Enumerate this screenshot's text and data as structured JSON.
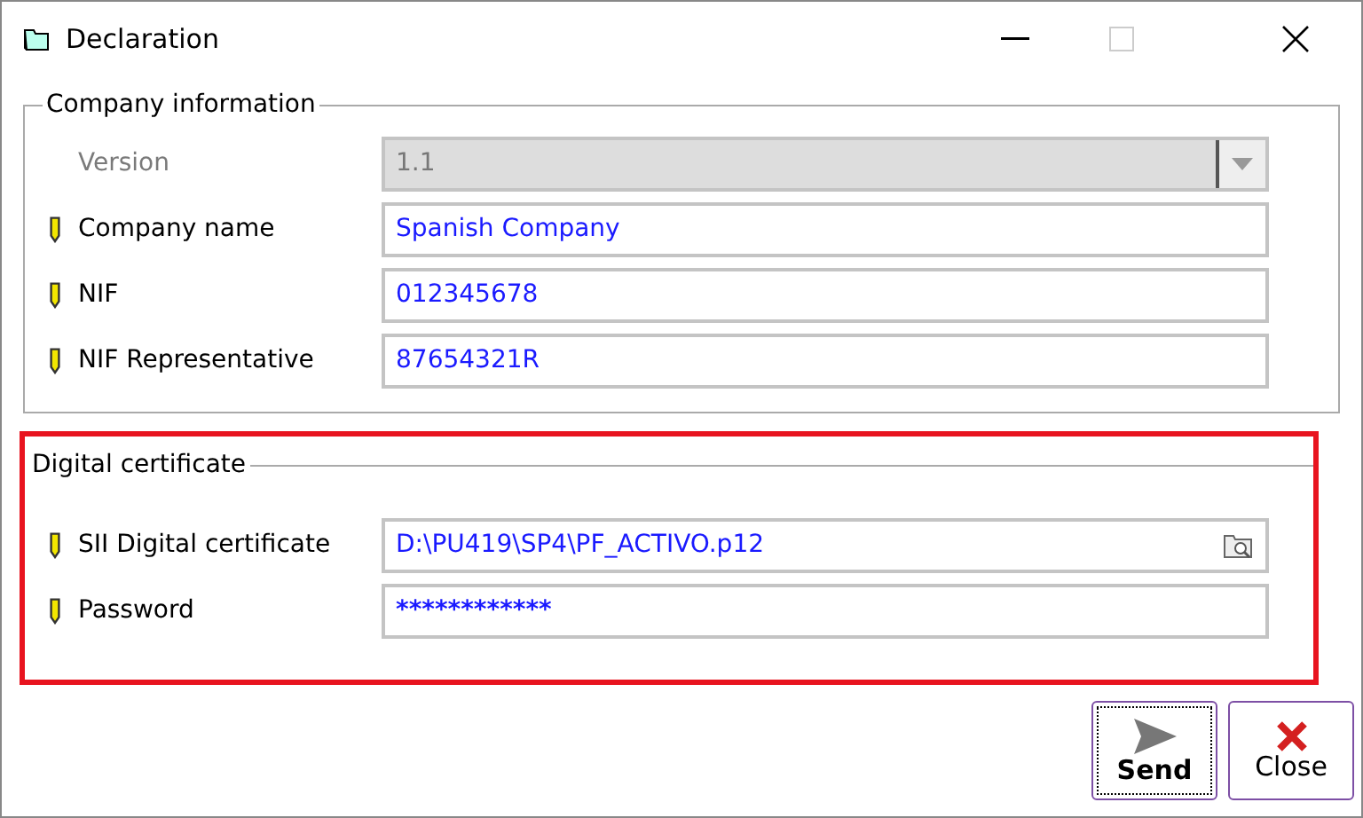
{
  "window": {
    "title": "Declaration"
  },
  "sections": [
    {
      "legend": "Company information",
      "highlighted": false,
      "fields": [
        {
          "kind": "select",
          "label": "Version",
          "value": "1.1",
          "required": false,
          "disabled": true
        },
        {
          "kind": "text",
          "label": "Company name",
          "value": "Spanish Company",
          "required": true,
          "disabled": false
        },
        {
          "kind": "text",
          "label": "NIF",
          "value": "012345678",
          "required": true,
          "disabled": false
        },
        {
          "kind": "text",
          "label": "NIF Representative",
          "value": "87654321R",
          "required": true,
          "disabled": false
        }
      ]
    },
    {
      "legend": "Digital certificate",
      "highlighted": true,
      "fields": [
        {
          "kind": "file",
          "label": "SII Digital certificate",
          "value": "D:\\PU419\\SP4\\PF_ACTIVO.p12",
          "required": true,
          "disabled": false
        },
        {
          "kind": "password",
          "label": "Password",
          "value": "************",
          "required": true,
          "disabled": false
        }
      ]
    }
  ],
  "buttons": [
    {
      "kind": "send",
      "label": "Send",
      "default": true
    },
    {
      "kind": "close",
      "label": "Close",
      "default": false
    }
  ]
}
